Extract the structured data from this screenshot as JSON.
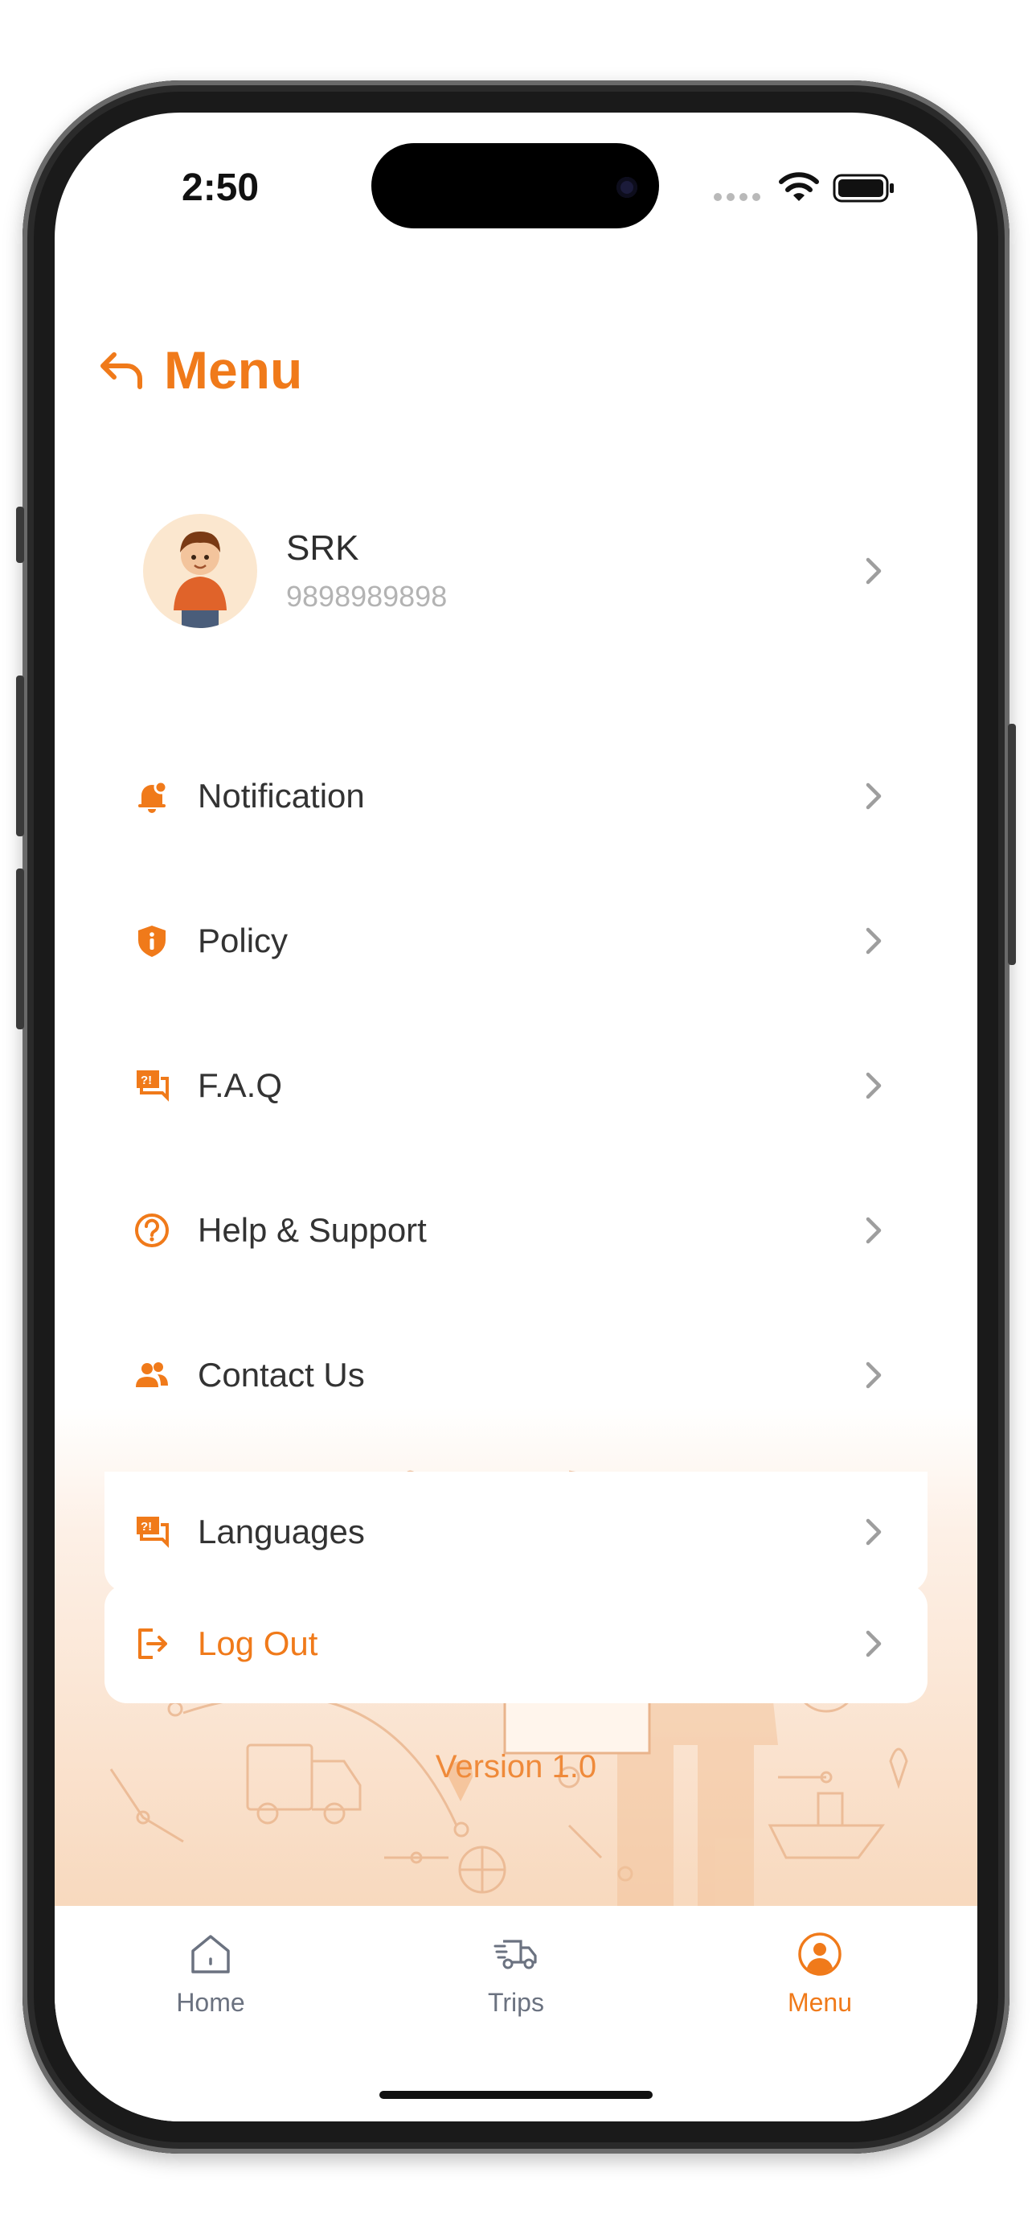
{
  "status_bar": {
    "time": "2:50"
  },
  "header": {
    "title": "Menu"
  },
  "profile": {
    "name": "SRK",
    "phone": "9898989898"
  },
  "menu_items": [
    {
      "label": "Notification",
      "icon": "bell-icon"
    },
    {
      "label": "Policy",
      "icon": "shield-info-icon"
    },
    {
      "label": "F.A.Q",
      "icon": "faq-chat-icon"
    },
    {
      "label": "Help & Support",
      "icon": "question-circle-icon"
    },
    {
      "label": "Contact Us",
      "icon": "people-icon"
    },
    {
      "label": "Languages",
      "icon": "language-chat-icon"
    }
  ],
  "logout": {
    "label": "Log Out",
    "icon": "logout-icon"
  },
  "version": "Version 1.0",
  "tabs": [
    {
      "label": "Home",
      "icon": "home-icon",
      "active": false
    },
    {
      "label": "Trips",
      "icon": "truck-icon",
      "active": false
    },
    {
      "label": "Menu",
      "icon": "user-circle-icon",
      "active": true
    }
  ],
  "colors": {
    "accent": "#f07a1a",
    "inactive_tab": "#6b7280",
    "chevron": "#9e9e9e"
  }
}
